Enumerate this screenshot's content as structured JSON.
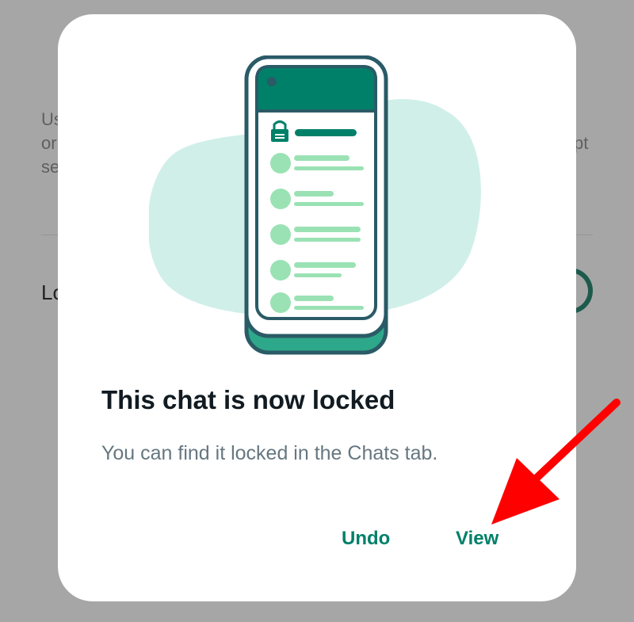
{
  "background": {
    "description_lines": [
      "Us",
      "or",
      "se"
    ],
    "description_right": "pt",
    "row_label": "Lo"
  },
  "dialog": {
    "title": "This chat is now locked",
    "body": "You can find it locked in the Chats tab.",
    "buttons": {
      "undo": "Undo",
      "view": "View"
    }
  },
  "colors": {
    "accent": "#008069",
    "phone_header": "#008069",
    "bubble": "#d0efe9",
    "list_green": "#9ae2b4",
    "arrow": "#ff0000",
    "scrim": "#a6a6a6"
  },
  "icons": [
    "lock-icon",
    "phone-illustration",
    "annotation-arrow"
  ]
}
